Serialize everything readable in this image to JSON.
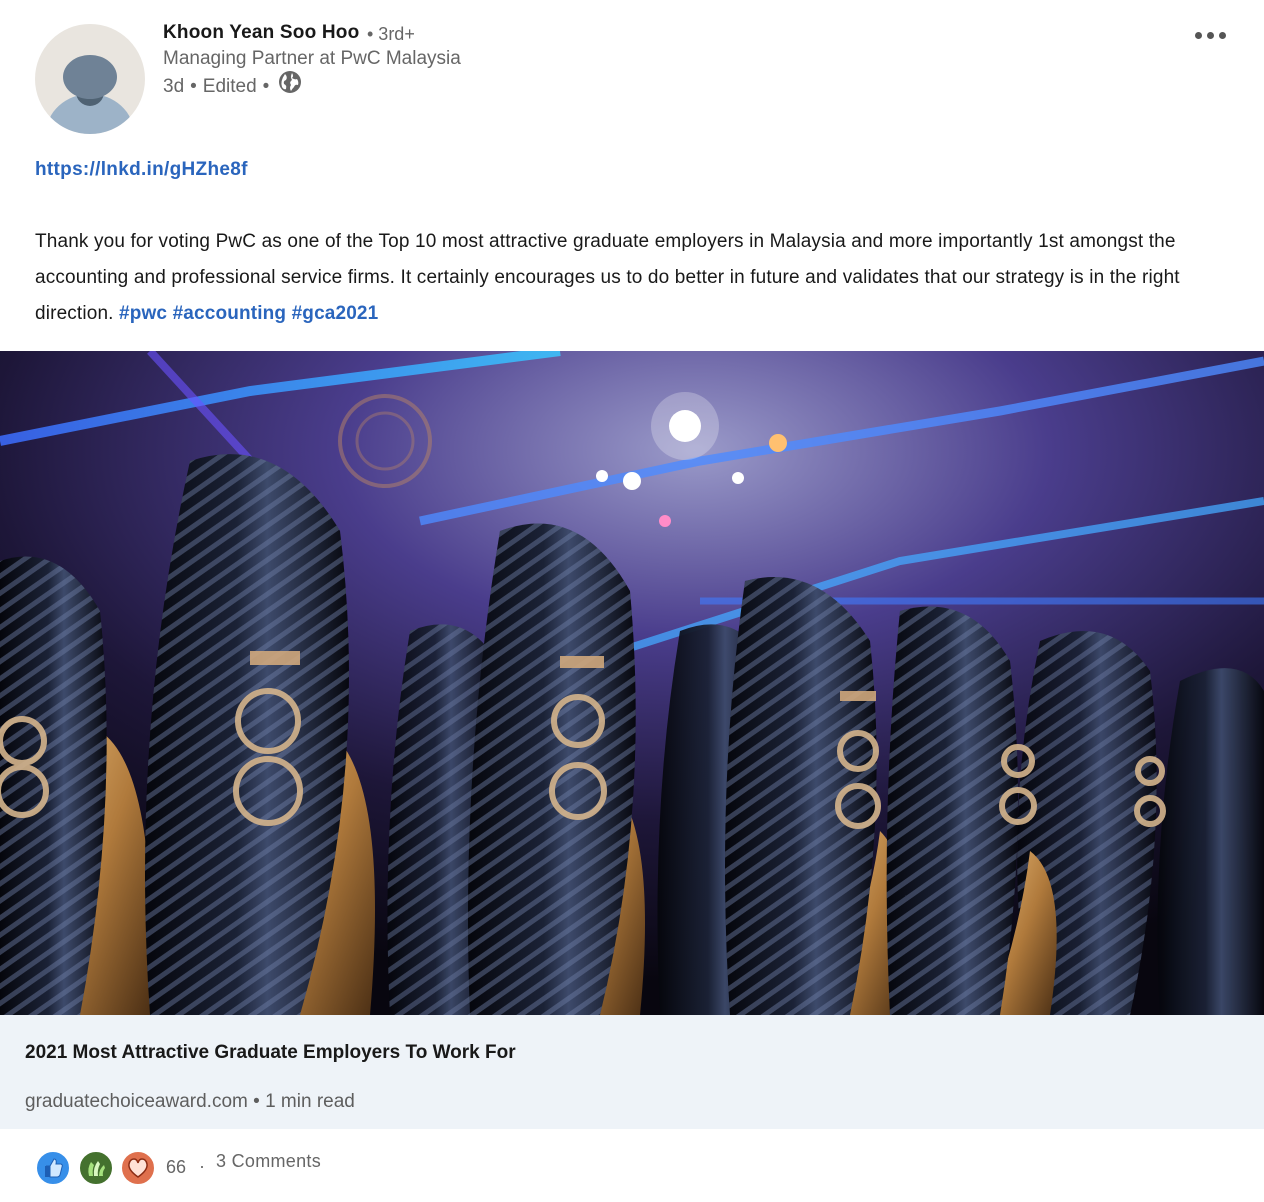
{
  "author": {
    "name": "Khoon Yean Soo Hoo",
    "degree": "• 3rd+",
    "headline": "Managing Partner at PwC Malaysia",
    "time": "3d",
    "edited": "Edited",
    "visibility_icon": "globe-icon"
  },
  "post": {
    "link": "https://lnkd.in/gHZhe8f",
    "text": "Thank you for voting PwC as one of the Top 10 most attractive graduate employers in Malaysia and more importantly 1st amongst the accounting and professional service firms. It certainly encourages us to do better in future and validates that our strategy is in the right direction. ",
    "hashtags": [
      "#pwc",
      "#accounting",
      "#gca2021"
    ]
  },
  "preview": {
    "title": "2021 Most Attractive Graduate Employers To Work For",
    "source": "graduatechoiceaward.com",
    "read_time": "1 min read"
  },
  "social": {
    "reactions": [
      "like-icon",
      "celebrate-icon",
      "love-icon"
    ],
    "reaction_count": "66",
    "comments": "3 Comments"
  },
  "colors": {
    "link": "#2a65bd",
    "preview_bg": "#eef3f8",
    "like": "#378fe9",
    "celebrate": "#44712e",
    "love": "#df704d"
  }
}
